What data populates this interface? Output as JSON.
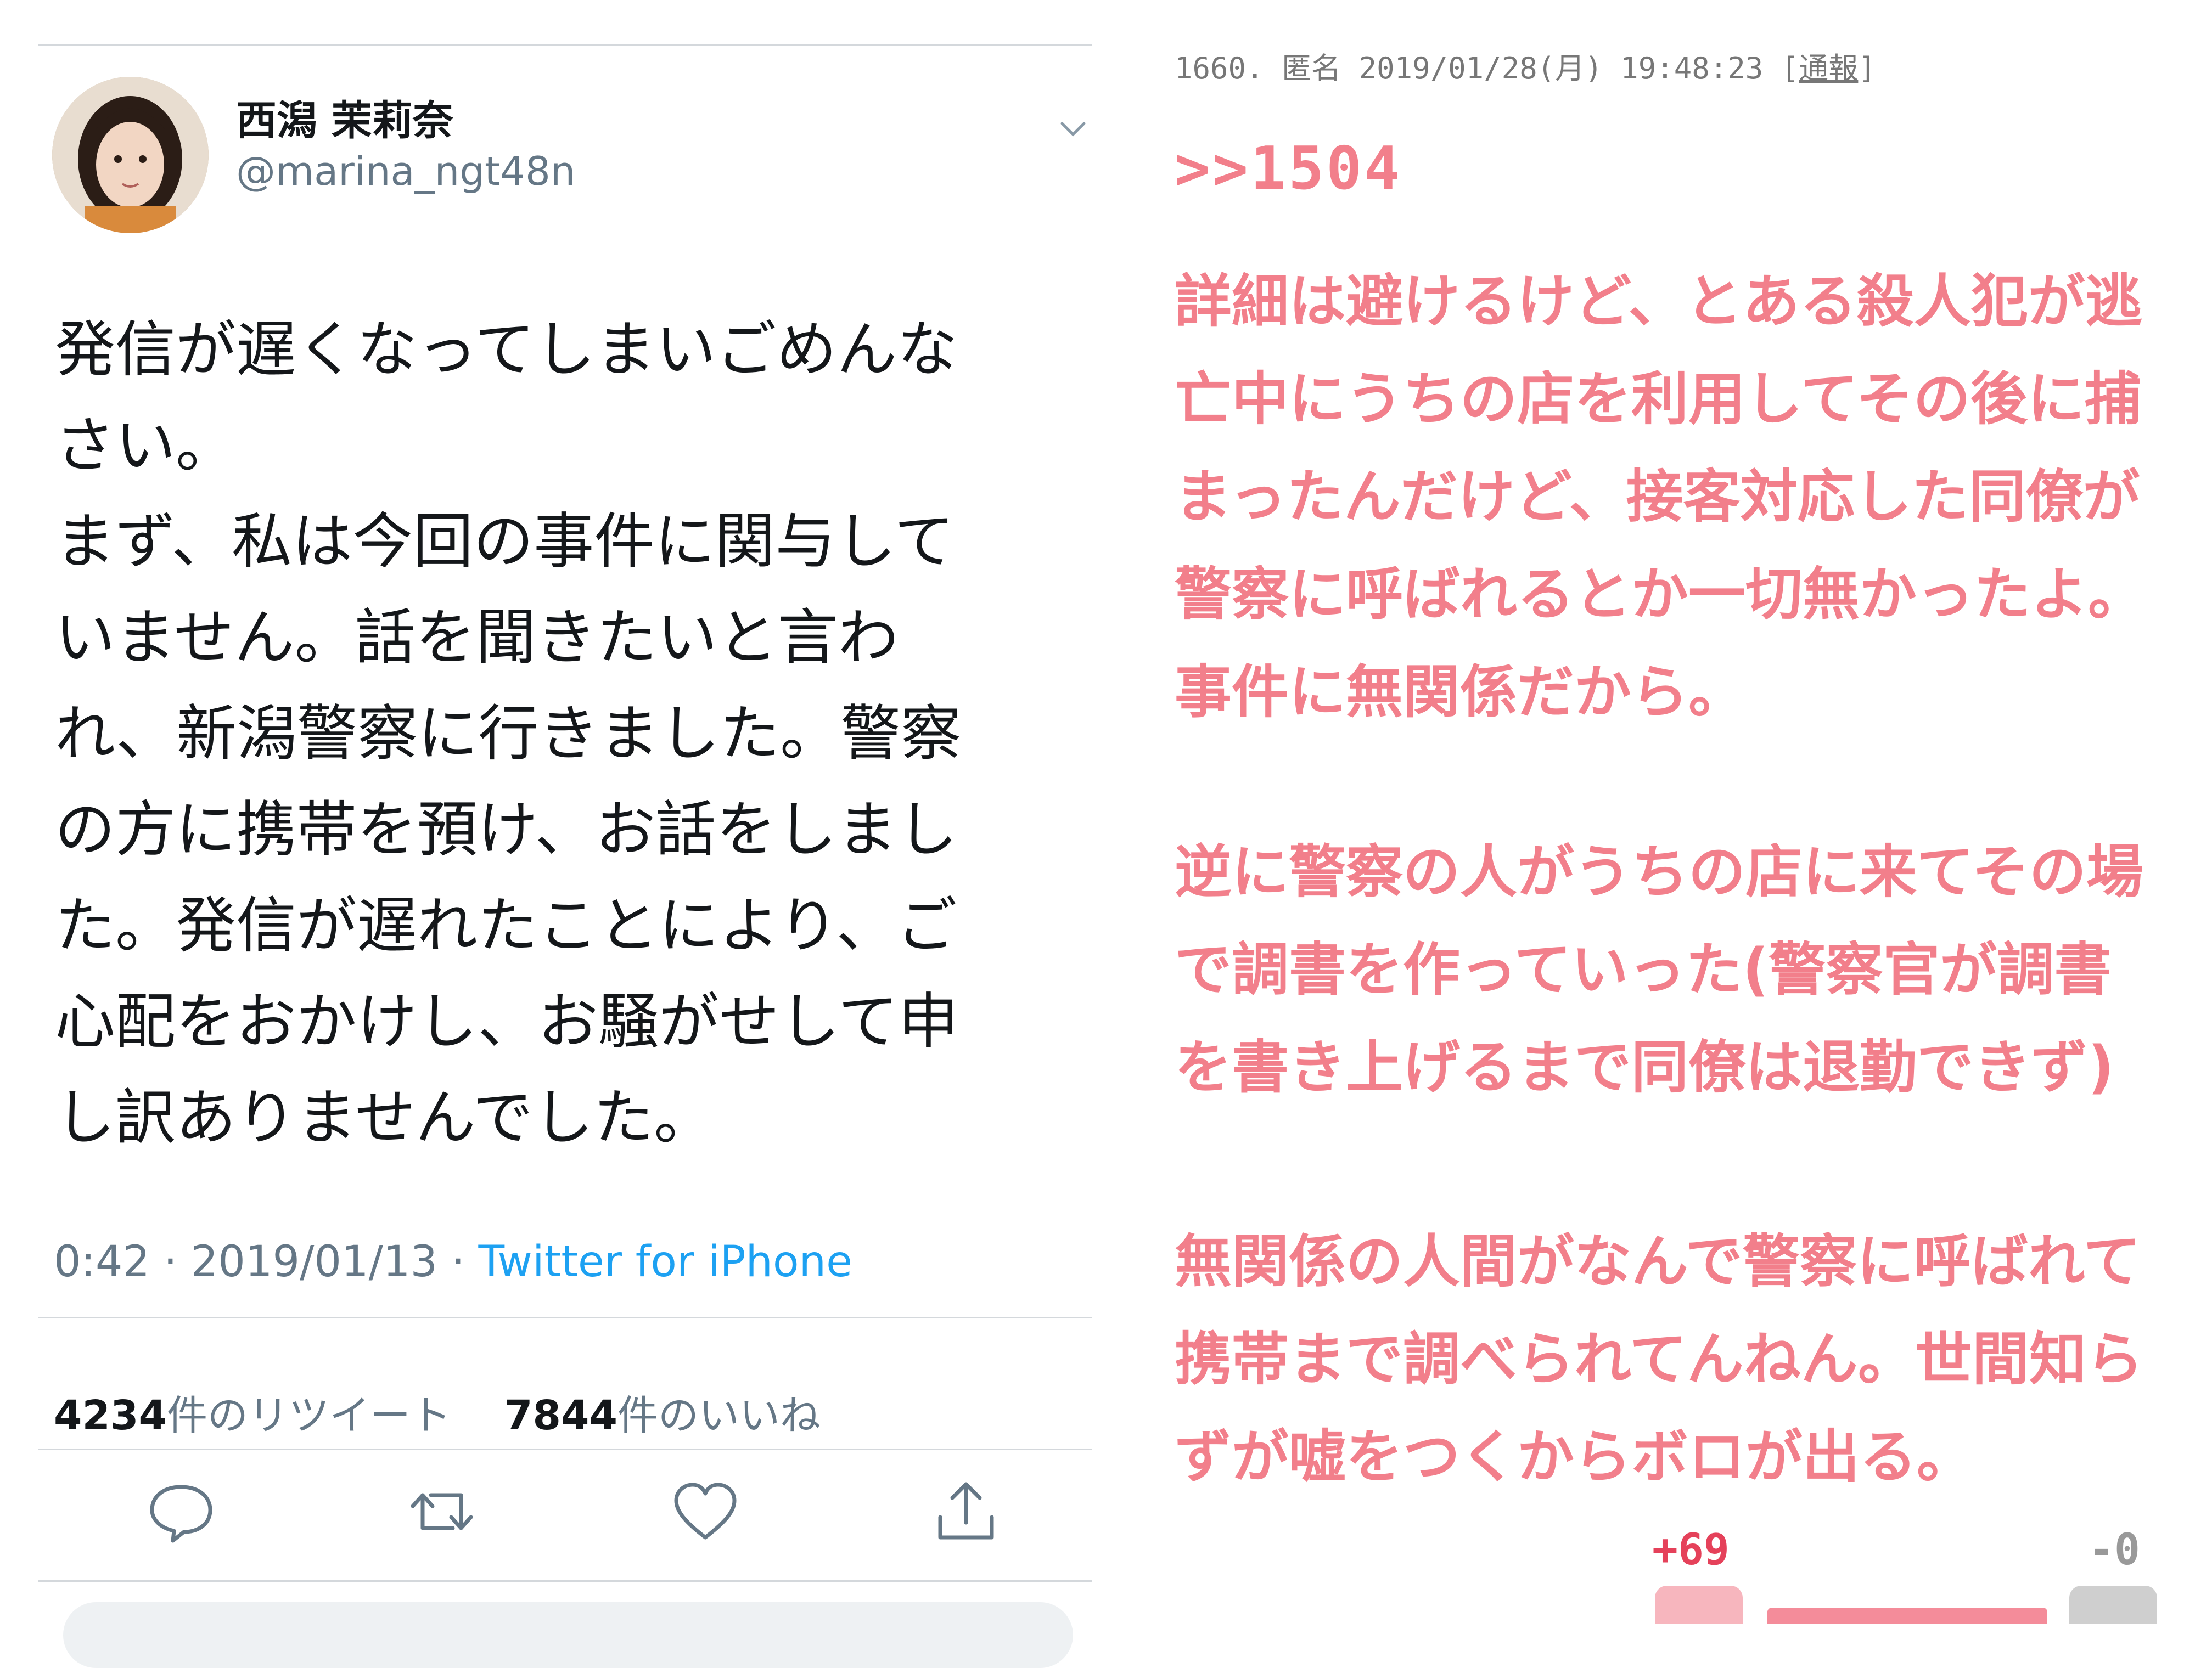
{
  "tweet": {
    "display_name": "西潟 茉莉奈",
    "handle": "@marina_ngt48n",
    "text": "発信が遅くなってしまいごめんな\nさい。\nまず、私は今回の事件に関与して\nいません。話を聞きたいと言わ\nれ、新潟警察に行きました。警察\nの方に携帯を預け、お話をしまし\nた。発信が遅れたことにより、ご\n心配をおかけし、お騒がせして申\nし訳ありませんでした。",
    "time": "0:42",
    "date": "2019/01/13",
    "source": "Twitter for iPhone",
    "retweet_count": "4234",
    "retweet_label": "件のリツイート",
    "like_count": "7844",
    "like_label": "件のいいね",
    "icons": [
      "chevron-down-icon",
      "reply-icon",
      "retweet-icon",
      "like-icon",
      "share-icon"
    ]
  },
  "post": {
    "number": "1660.",
    "author": "匿名",
    "datetime": "2019/01/28(月) 19:48:23",
    "report_label": "通報",
    "reply_to": ">>1504",
    "paragraphs": [
      "詳細は避けるけど、とある殺人犯が逃\n亡中にうちの店を利用してその後に捕\nまったんだけど、接客対応した同僚が\n警察に呼ばれるとか一切無かったよ。\n事件に無関係だから。",
      "逆に警察の人がうちの店に来てその場\nで調書を作っていった(警察官が調書\nを書き上げるまで同僚は退勤できず)",
      "無関係の人間がなんで警察に呼ばれて\n携帯まで調べられてんねん。世間知ら\nずが嘘をつくからボロが出る。"
    ],
    "votes_up": "+69",
    "votes_down": "-0",
    "colors": {
      "text_pink": "#f27f8b",
      "vote_red": "#e5415a"
    }
  }
}
